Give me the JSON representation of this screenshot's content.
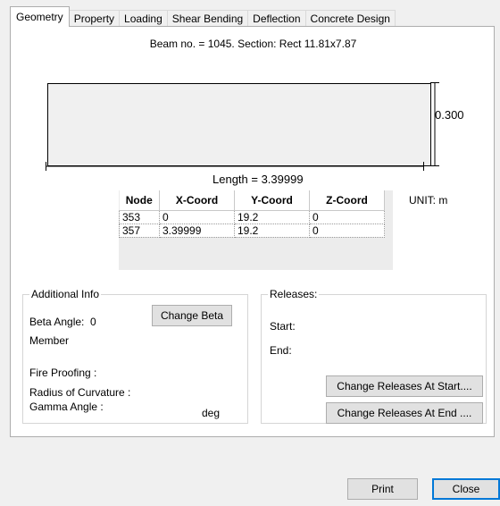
{
  "tabs": [
    {
      "label": "Geometry",
      "active": true
    },
    {
      "label": "Property",
      "active": false
    },
    {
      "label": "Loading",
      "active": false
    },
    {
      "label": "Shear Bending",
      "active": false
    },
    {
      "label": "Deflection",
      "active": false
    },
    {
      "label": "Concrete Design",
      "active": false
    }
  ],
  "geometry": {
    "beam_title": "Beam no. = 1045. Section: Rect 11.81x7.87",
    "height_dim": "0.300",
    "length_label": "Length = 3.39999",
    "unit_label": "UNIT: m",
    "table": {
      "headers": [
        "Node",
        "X-Coord",
        "Y-Coord",
        "Z-Coord"
      ],
      "rows": [
        [
          "353",
          "0",
          "19.2",
          "0"
        ],
        [
          "357",
          "3.39999",
          "19.2",
          "0"
        ]
      ]
    }
  },
  "additional_info": {
    "title": "Additional Info",
    "beta_angle_label": "Beta Angle:",
    "beta_angle_value": "0",
    "member_label": "Member",
    "change_beta_button": "Change Beta",
    "fire_proofing_label": "Fire Proofing :",
    "radius_label": "Radius of Curvature :",
    "gamma_label": "Gamma Angle :",
    "gamma_unit": "deg"
  },
  "releases": {
    "title": "Releases:",
    "start_label": "Start:",
    "end_label": "End:",
    "change_start_button": "Change Releases At Start....",
    "change_end_button": "Change Releases At End ...."
  },
  "footer": {
    "print_button": "Print",
    "close_button": "Close"
  },
  "colors": {
    "dialog_bg": "#f0f0f0",
    "panel_bg": "#ffffff",
    "default_button_border": "#0078d7"
  }
}
